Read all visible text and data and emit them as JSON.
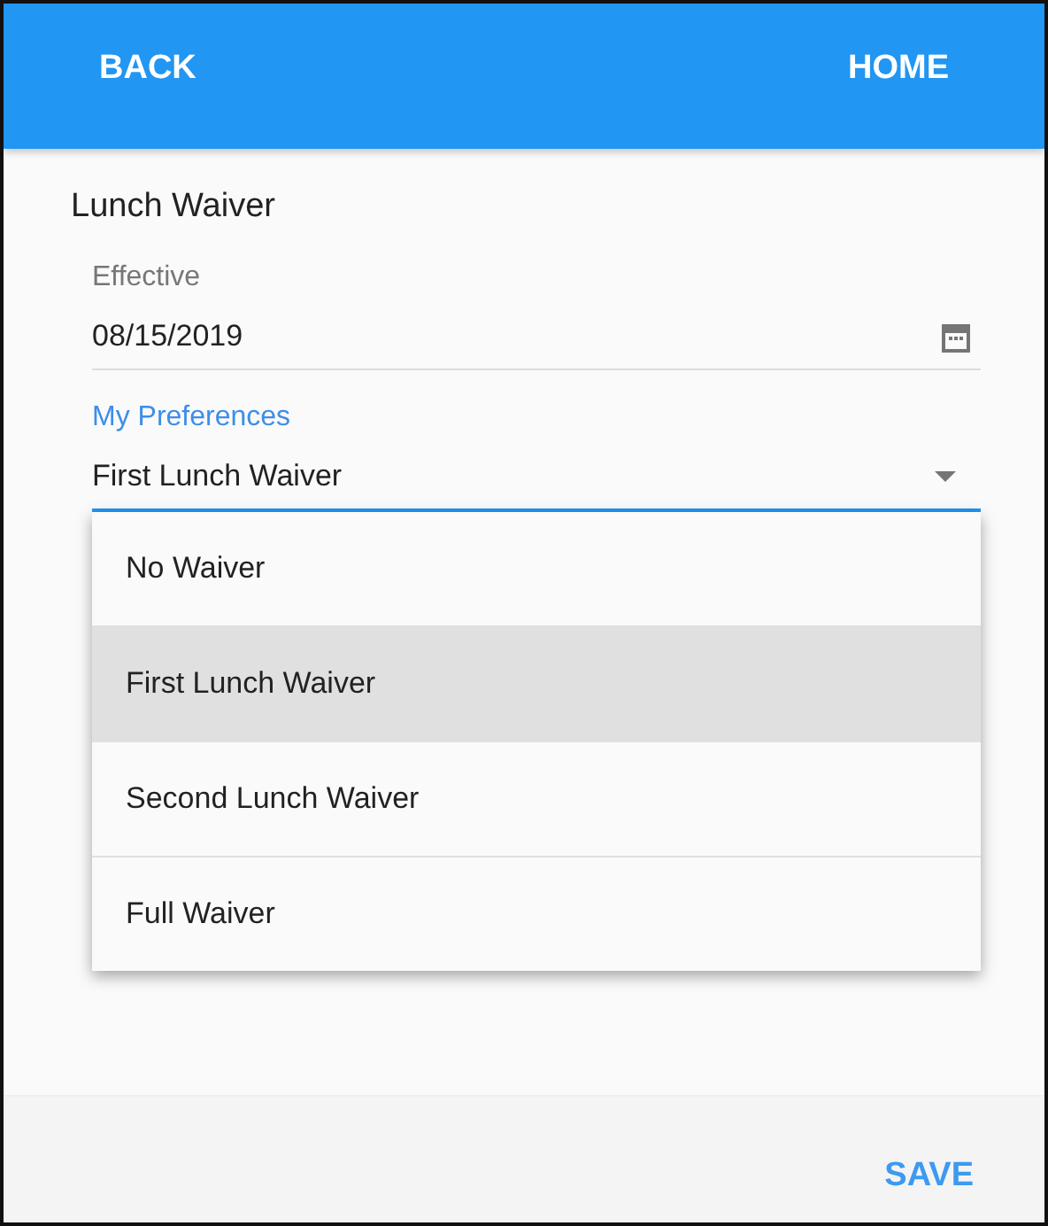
{
  "header": {
    "back": "BACK",
    "home": "HOME"
  },
  "title": "Lunch Waiver",
  "effective": {
    "label": "Effective",
    "value": "08/15/2019"
  },
  "preferences": {
    "label": "My Preferences",
    "value": "First Lunch Waiver",
    "expanded": true,
    "options": [
      {
        "label": "No Waiver",
        "selected": false
      },
      {
        "label": "First Lunch Waiver",
        "selected": true
      },
      {
        "label": "Second Lunch Waiver",
        "selected": false
      },
      {
        "label": "Full Waiver",
        "selected": false
      }
    ]
  },
  "footer": {
    "save": "SAVE"
  }
}
